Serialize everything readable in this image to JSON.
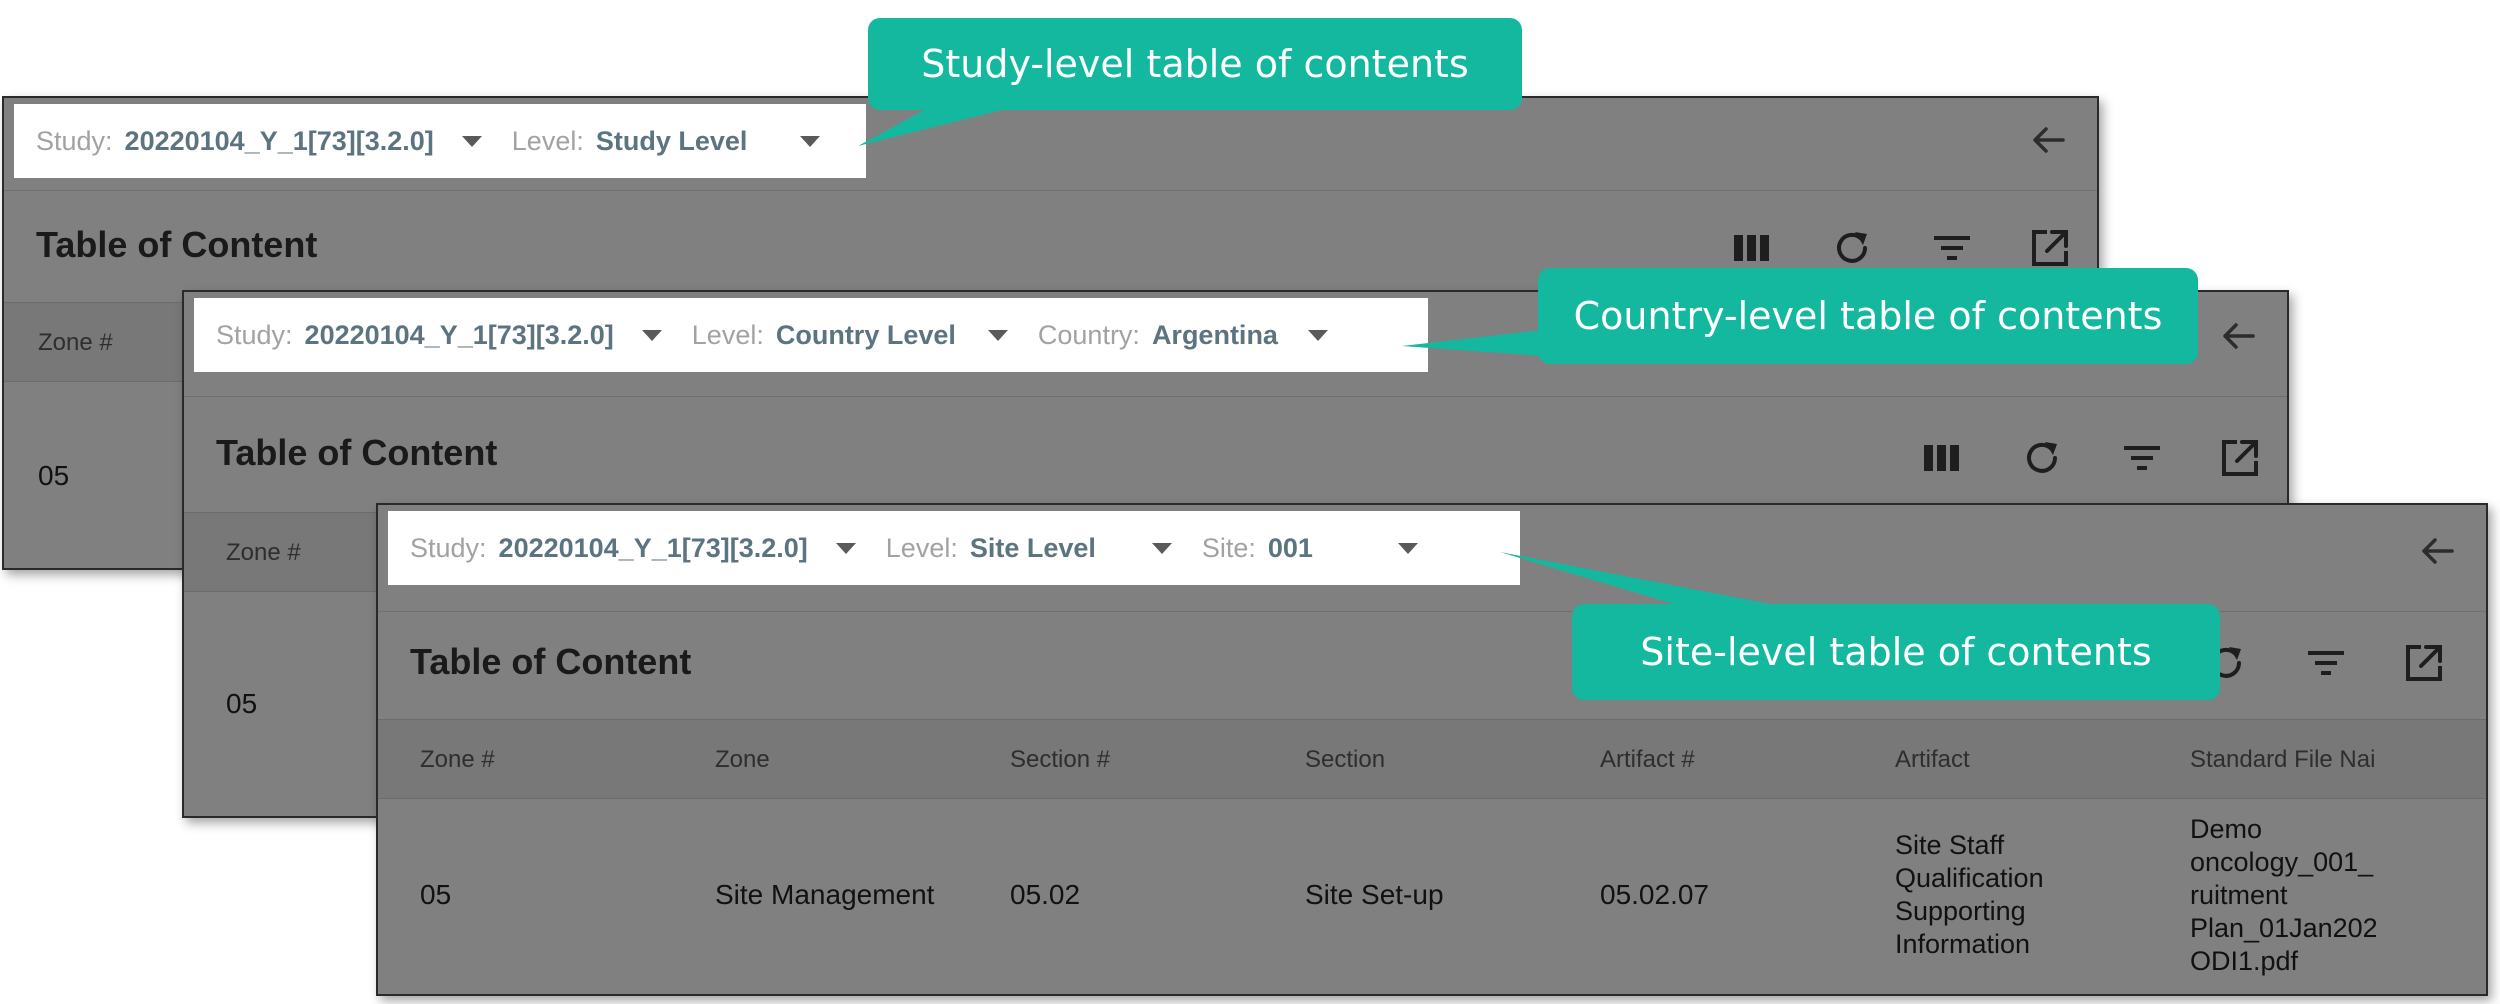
{
  "panels": {
    "study": {
      "study_label": "Study:",
      "study_value": "20220104_Y_1[73][3.2.0]",
      "level_label": "Level:",
      "level_value": "Study Level",
      "title": "Table of Content",
      "zone_header": "Zone #",
      "zone_value": "05"
    },
    "country": {
      "study_label": "Study:",
      "study_value": "20220104_Y_1[73][3.2.0]",
      "level_label": "Level:",
      "level_value": "Country Level",
      "country_label": "Country:",
      "country_value": "Argentina",
      "title": "Table of Content",
      "zone_header": "Zone #",
      "zone_value": "05"
    },
    "site": {
      "study_label": "Study:",
      "study_value": "20220104_Y_1[73][3.2.0]",
      "level_label": "Level:",
      "level_value": "Site Level",
      "site_label": "Site:",
      "site_value": "001",
      "title": "Table of Content",
      "columns": [
        "Zone #",
        "Zone",
        "Section #",
        "Section",
        "Artifact #",
        "Artifact",
        "Standard File Nai"
      ],
      "row": {
        "zone_num": "05",
        "zone": "Site Management",
        "section_num": "05.02",
        "section": "Site Set-up",
        "artifact_num": "05.02.07",
        "artifact_lines": [
          "Site Staff",
          "Qualification",
          "Supporting",
          "Information"
        ],
        "filename_lines": [
          "Demo",
          "oncology_001_",
          "ruitment",
          "Plan_01Jan202",
          "ODI1.pdf"
        ]
      }
    }
  },
  "callouts": {
    "study": "Study-level table of contents",
    "country": "Country-level table of contents",
    "site": "Site-level table of contents"
  },
  "icons": [
    "back-arrow-icon",
    "columns-icon",
    "refresh-icon",
    "filter-icon",
    "external-link-icon"
  ],
  "colors": {
    "callout": "#13b89f",
    "panel_bg": "#808080",
    "value_text": "#5c7380"
  }
}
